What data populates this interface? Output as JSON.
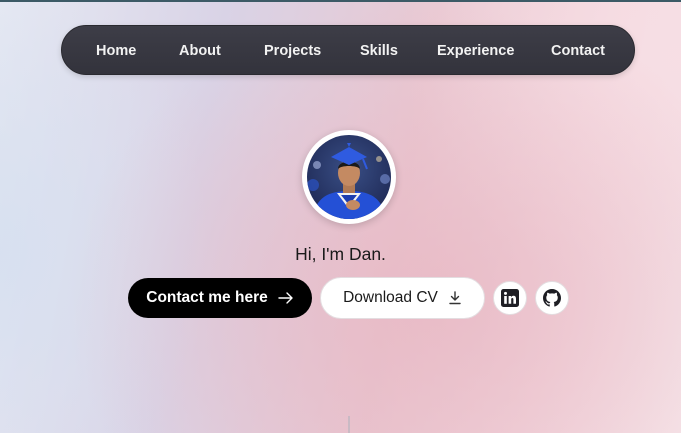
{
  "nav": {
    "items": [
      {
        "label": "Home"
      },
      {
        "label": "About"
      },
      {
        "label": "Projects"
      },
      {
        "label": "Skills"
      },
      {
        "label": "Experience"
      },
      {
        "label": "Contact"
      }
    ]
  },
  "hero": {
    "greeting": "Hi, I'm Dan.",
    "contact_button": "Contact me here",
    "cv_button": "Download CV",
    "icons": {
      "contact_arrow": "arrow-right-icon",
      "cv_download": "download-icon",
      "linkedin": "linkedin-icon",
      "github": "github-icon"
    }
  },
  "colors": {
    "nav_bg": "#383842",
    "primary_button": "#000000",
    "secondary_button": "#ffffff"
  }
}
